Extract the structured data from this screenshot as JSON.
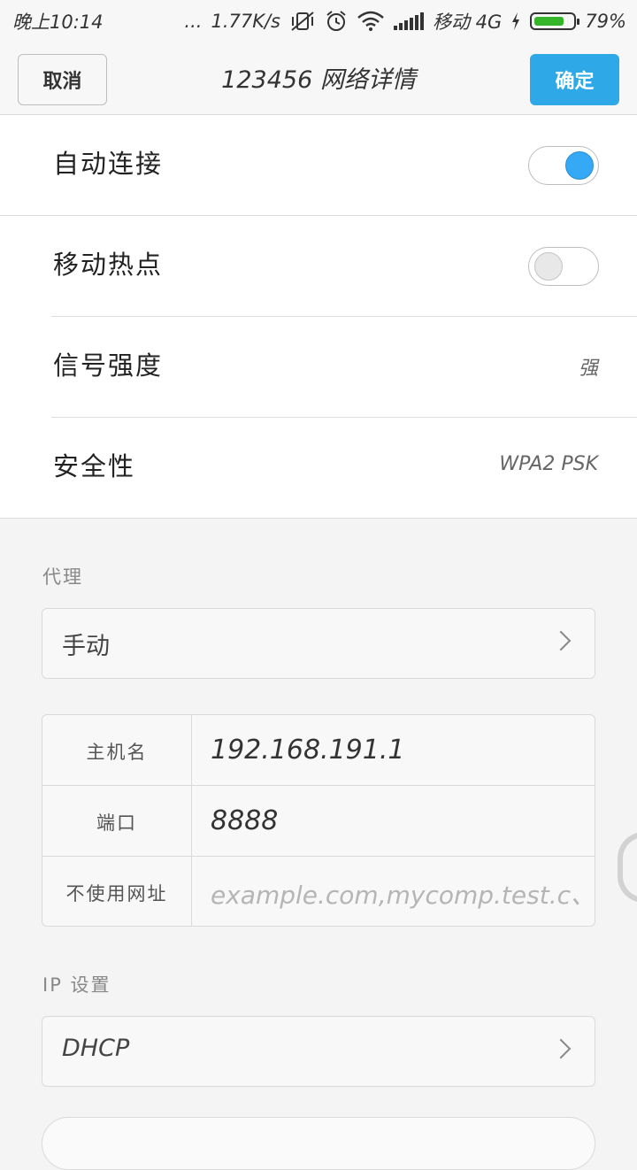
{
  "status_bar": {
    "time": "晚上10:14",
    "dots": "...",
    "speed": "1.77K/s",
    "carrier": "移动 4G",
    "battery_percent": "79%",
    "battery_level": 0.79,
    "icons": [
      "vibrate-off-icon",
      "alarm-icon",
      "wifi-icon",
      "signal-icon",
      "charging-icon",
      "battery-icon"
    ]
  },
  "header": {
    "cancel_label": "取消",
    "title": "123456 网络详情",
    "confirm_label": "确定"
  },
  "settings": [
    {
      "label": "自动连接",
      "toggle": true
    },
    {
      "label": "移动热点",
      "toggle": false
    },
    {
      "label": "信号强度",
      "value": "强"
    },
    {
      "label": "安全性",
      "value": "WPA2 PSK"
    }
  ],
  "proxy": {
    "section_label": "代理",
    "mode": "手动",
    "fields": [
      {
        "label": "主机名",
        "value": "192.168.191.1"
      },
      {
        "label": "端口",
        "value": "8888"
      },
      {
        "label": "不使用网址",
        "placeholder": "example.com,mycomp.test.c、"
      }
    ]
  },
  "ip": {
    "section_label": "IP 设置",
    "mode": "DHCP"
  },
  "colors": {
    "accent": "#2ea8e6",
    "toggle_on": "#35a9f5",
    "battery": "#35b62a"
  }
}
